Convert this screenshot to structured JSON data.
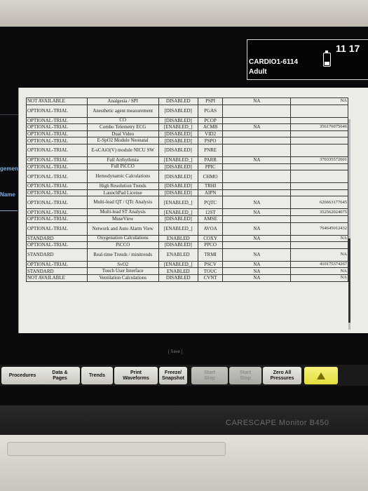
{
  "header": {
    "bed_name": "CARDIO1-6114",
    "patient_type": "Adult",
    "clock": "11 17"
  },
  "left_labels": [
    "gement",
    "Name"
  ],
  "table_rows": [
    {
      "status": "NOT AVAILABLE",
      "license": "Analgesia / SPI",
      "state": "DISABLED",
      "code": "PSPI",
      "id": "NA",
      "key": "NA"
    },
    {
      "status": "OPTIONAL-TRIAL",
      "license": "Anesthetic agent measurement",
      "state": "[DISABLED]",
      "code": "PGAS",
      "id": "",
      "key": ""
    },
    {
      "status": "OPTIONAL-TRIAL",
      "license": "CO",
      "state": "[DISABLED]",
      "code": "PCOP",
      "id": "",
      "key": ""
    },
    {
      "status": "OPTIONAL-TRIAL",
      "license": "Combo Telemetry ECG",
      "state": "[ENABLED_]",
      "code": "ACMB",
      "id": "NA",
      "key": "356176075646"
    },
    {
      "status": "OPTIONAL-TRIAL",
      "license": "Dual Video",
      "state": "[DISABLED]",
      "code": "VID2",
      "id": "",
      "key": ""
    },
    {
      "status": "OPTIONAL-TRIAL",
      "license": "E-SpO2 Module Neonatal",
      "state": "[DISABLED]",
      "code": "PSPO",
      "id": "",
      "key": ""
    },
    {
      "status": "OPTIONAL-TRIAL",
      "license": "E-sCAiO(V) module NICU SW",
      "state": "[DISABLED]",
      "code": "PNRE",
      "id": "",
      "key": ""
    },
    {
      "status": "OPTIONAL-TRIAL",
      "license": "Full Arrhythmia",
      "state": "[ENABLED_]",
      "code": "PARR",
      "id": "NA",
      "key": "370335572601"
    },
    {
      "status": "OPTIONAL-TRIAL",
      "license": "Full PiCCO",
      "state": "[DISABLED]",
      "code": "PPIC",
      "id": "",
      "key": ""
    },
    {
      "status": "OPTIONAL-TRIAL",
      "license": "Hemodynamic Calculations",
      "state": "[DISABLED]",
      "code": "CHMO",
      "id": "",
      "key": ""
    },
    {
      "status": "OPTIONAL-TRIAL",
      "license": "High Resolution Trends",
      "state": "[DISABLED]",
      "code": "TRHI",
      "id": "",
      "key": ""
    },
    {
      "status": "OPTIONAL-TRIAL",
      "license": "LaunchPad License",
      "state": "[DISABLED]",
      "code": "AIPN",
      "id": "",
      "key": ""
    },
    {
      "status": "OPTIONAL-TRIAL",
      "license": "Multi-lead QT / QTc Analysis",
      "state": "[ENABLED_]",
      "code": "PQTC",
      "id": "NA",
      "key": "626663177645"
    },
    {
      "status": "OPTIONAL-TRIAL",
      "license": "Multi-lead ST Analysis",
      "state": "[ENABLED_]",
      "code": "12ST",
      "id": "NA",
      "key": "352562024075"
    },
    {
      "status": "OPTIONAL-TRIAL",
      "license": "MuseView",
      "state": "[DISABLED]",
      "code": "AMSE",
      "id": "",
      "key": ""
    },
    {
      "status": "OPTIONAL-TRIAL",
      "license": "Network and Auto Alarm View",
      "state": "[ENABLED_]",
      "code": "AVOA",
      "id": "NA",
      "key": "764645012432"
    },
    {
      "status": "STANDARD",
      "license": "Oxygenation Calculations",
      "state": "ENABLED",
      "code": "COXY",
      "id": "NA",
      "key": "NA"
    },
    {
      "status": "OPTIONAL-TRIAL",
      "license": "PiCCO",
      "state": "[DISABLED]",
      "code": "PPCO",
      "id": "",
      "key": ""
    },
    {
      "status": "STANDARD",
      "license": "Real-time Trends / minitrends",
      "state": "ENABLED",
      "code": "TRMI",
      "id": "NA",
      "key": "NA"
    },
    {
      "status": "OPTIONAL-TRIAL",
      "license": "SvO2",
      "state": "[ENABLED_]",
      "code": "PSCV",
      "id": "NA",
      "key": "410175374267"
    },
    {
      "status": "STANDARD",
      "license": "Touch User Interface",
      "state": "ENABLED",
      "code": "TOUC",
      "id": "NA",
      "key": "NA"
    },
    {
      "status": "NOT AVAILABLE",
      "license": "Ventilation Calculations",
      "state": "DISABLED",
      "code": "CVNT",
      "id": "NA",
      "key": "NA"
    }
  ],
  "save_label": "[ Save ]",
  "buttons": {
    "procedures": "Procedures",
    "data_pages": "Data &\nPages",
    "trends": "Trends",
    "print_waveforms": "Print\nWaveforms",
    "freeze_snapshot": "Freeze/\nSnapshot",
    "dim1": "Start\nStop",
    "dim2": "Start\nStop",
    "zero_all": "Zero All\nPressures"
  },
  "device_brand": "CARESCAPE Monitor B450",
  "colors": {
    "alarm_yellow": "#eae34f",
    "screen_bg": "#0b0b0d",
    "panel_bg": "#ecebe6"
  }
}
